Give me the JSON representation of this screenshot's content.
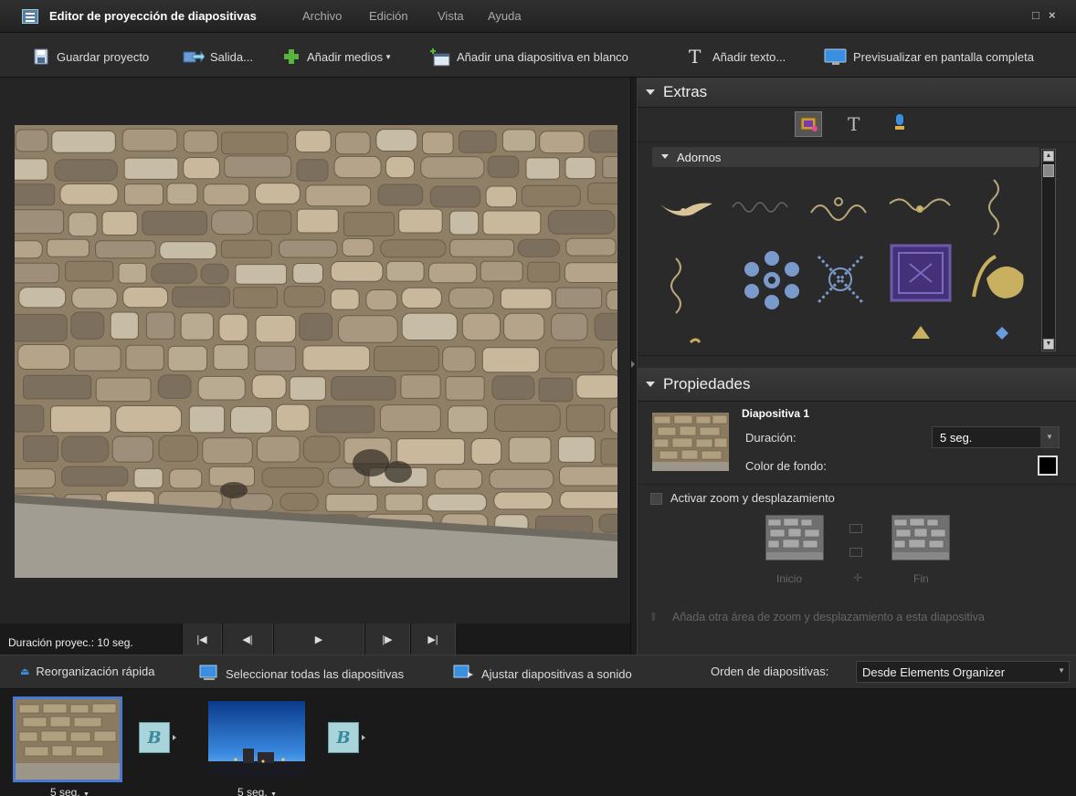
{
  "window": {
    "title": "Editor de proyección de diapositivas",
    "menu": [
      "Archivo",
      "Edición",
      "Vista",
      "Ayuda"
    ],
    "controls": [
      "restore-icon",
      "close-icon"
    ]
  },
  "toolbar": {
    "save": "Guardar proyecto",
    "output": "Salida...",
    "add_media": "Añadir medios",
    "add_blank": "Añadir una diapositiva en blanco",
    "add_text": "Añadir texto...",
    "preview_full": "Previsualizar en pantalla completa"
  },
  "preview": {
    "duration_label": "Duración proyec.: 10 seg.",
    "controls": [
      "first-icon",
      "prev-icon",
      "play-icon",
      "next-icon",
      "last-icon"
    ]
  },
  "extras": {
    "title": "Extras",
    "tabs": [
      "graphics-icon",
      "text-icon",
      "narration-icon"
    ],
    "adornos": {
      "title": "Adornos",
      "items": [
        "ornament-1",
        "ornament-2",
        "ornament-3",
        "ornament-4",
        "ornament-5",
        "ornament-6",
        "flower-icon",
        "snowflake-icon",
        "frame-icon",
        "leaf-icon",
        "swirl-icon",
        "triangle-icon",
        "diamond-icon"
      ]
    }
  },
  "properties": {
    "title": "Propiedades",
    "slide_name": "Diapositiva 1",
    "duration_label": "Duración:",
    "duration_value": "5 seg.",
    "bg_color_label": "Color de fondo:",
    "bg_color": "#000000",
    "zoom_label": "Activar zoom y desplazamiento",
    "zoom_checked": false,
    "start_label": "Inicio",
    "end_label": "Fin",
    "add_area": "Añada otra área de zoom y desplazamiento a esta diapositiva"
  },
  "bottombar": {
    "quick_reorder": "Reorganización rápida",
    "select_all": "Seleccionar todas las diapositivas",
    "fit_audio": "Ajustar diapositivas a sonido",
    "order_label": "Orden de diapositivas:",
    "order_value": "Desde Elements Organizer"
  },
  "filmstrip": {
    "slides": [
      {
        "duration": "5 seg.",
        "selected": true
      },
      {
        "duration": "5 seg.",
        "selected": false
      }
    ],
    "transition_letter": "B"
  }
}
